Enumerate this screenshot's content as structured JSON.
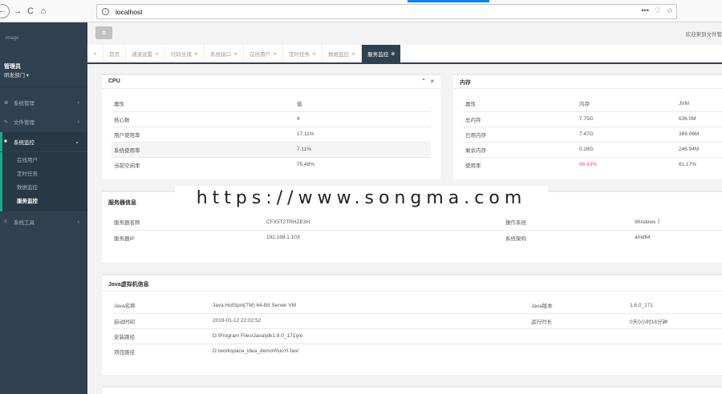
{
  "browser": {
    "url": "localhost",
    "more": "•••",
    "back": "←",
    "forward": "→",
    "reload": "C",
    "home": "⌂"
  },
  "sidebar": {
    "logo": "image",
    "user_name": "管理员",
    "user_dept": "研发部门 ▾",
    "menu": [
      {
        "label": "系统管理",
        "icon": "gear-icon",
        "glyph": "⚙",
        "arrow": "‹"
      },
      {
        "label": "文件管理",
        "icon": "edit-icon",
        "glyph": "✎",
        "arrow": "‹"
      },
      {
        "label": "系统监控",
        "icon": "video-icon",
        "glyph": "■",
        "arrow": "⌄"
      },
      {
        "label": "系统工具",
        "icon": "bars-icon",
        "glyph": "≡",
        "arrow": "‹"
      }
    ],
    "submenu": [
      "在线用户",
      "定时任务",
      "数据监控",
      "服务监控"
    ]
  },
  "header": {
    "menu_glyph": "≡",
    "welcome": "欢迎来到文件管"
  },
  "tabs": [
    {
      "label": "首页",
      "closable": false
    },
    {
      "label": "通道设置",
      "closable": true
    },
    {
      "label": "代码生成",
      "closable": true
    },
    {
      "label": "系统接口",
      "closable": true
    },
    {
      "label": "在线用户",
      "closable": true
    },
    {
      "label": "定时任务",
      "closable": true
    },
    {
      "label": "数据监控",
      "closable": true
    },
    {
      "label": "服务监控",
      "closable": true
    }
  ],
  "cpu": {
    "title": "CPU",
    "headers": [
      "属性",
      "值"
    ],
    "rows": [
      [
        "核心数",
        "4"
      ],
      [
        "用户使用率",
        "17.11%"
      ],
      [
        "系统使用率",
        "7.11%"
      ],
      [
        "当前空闲率",
        "75.48%"
      ]
    ]
  },
  "memory": {
    "title": "内存",
    "headers": [
      "属性",
      "内存",
      "JVM"
    ],
    "rows": [
      [
        "总内存",
        "7.75G",
        "636.0M"
      ],
      [
        "已用内存",
        "7.47G",
        "389.06M"
      ],
      [
        "剩余内存",
        "0.28G",
        "246.94M"
      ],
      [
        "使用率",
        "96.43%",
        "61.17%"
      ]
    ]
  },
  "server": {
    "title": "服务器信息",
    "rows": [
      [
        "服务器名称",
        "CFX5T2TRHZE3H",
        "操作系统",
        "Windows 7"
      ],
      [
        "服务器IP",
        "192.168.1.103",
        "系统架构",
        "amd64"
      ]
    ]
  },
  "jvm": {
    "title": "Java虚拟机信息",
    "rows": [
      [
        "Java名称",
        "Java HotSpot(TM) 64-Bit Server VM",
        "Java版本",
        "1.8.0_171"
      ],
      [
        "启动时间",
        "2019-01-12 22:02:52",
        "运行时长",
        "0天0小时16分钟"
      ],
      [
        "安装路径",
        "D:\\Program Files\\Java\\jdk1.8.0_171\\jre",
        "",
        ""
      ],
      [
        "项目路径",
        "D:\\workspace_idea_demo\\RuoYi-fast",
        "",
        ""
      ]
    ]
  },
  "watermark": "https://www.songma.com",
  "colors": {
    "sidebar": "#2f4050",
    "accent": "#19aa8d",
    "danger": "#ed5565"
  }
}
